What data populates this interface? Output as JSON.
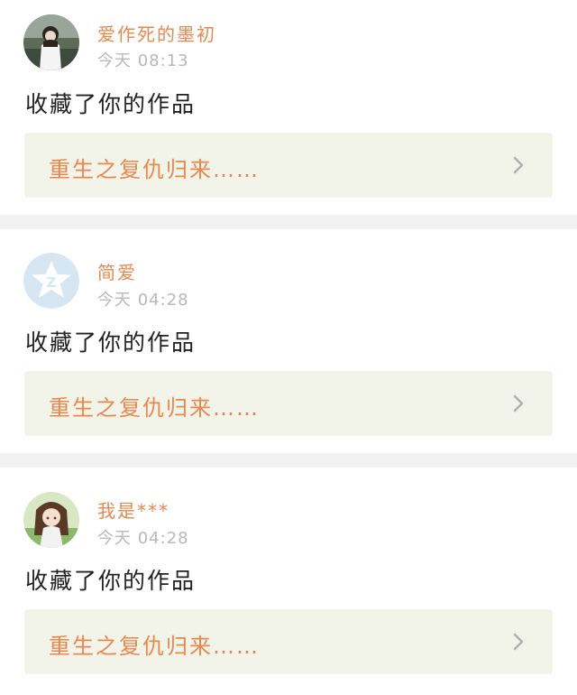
{
  "feed": {
    "items": [
      {
        "avatar": "girl-photo-avatar",
        "username": "爱作死的墨初",
        "time": "今天 08:13",
        "action": "收藏了你的作品",
        "work_title": "重生之复仇归来……"
      },
      {
        "avatar": "qzone-star-avatar",
        "username": "简爱",
        "time": "今天 04:28",
        "action": "收藏了你的作品",
        "work_title": "重生之复仇归来……"
      },
      {
        "avatar": "anime-girl-avatar",
        "username": "我是***",
        "time": "今天 04:28",
        "action": "收藏了你的作品",
        "work_title": "重生之复仇归来……"
      }
    ]
  },
  "icons": {
    "chevron": "chevron-right-icon"
  },
  "colors": {
    "accent": "#e8874f",
    "link_bg": "#f2f4ea",
    "timestamp": "#b8b8b8",
    "separator": "#f2f2f2",
    "avatar_star_bg": "#d6e6f2"
  }
}
